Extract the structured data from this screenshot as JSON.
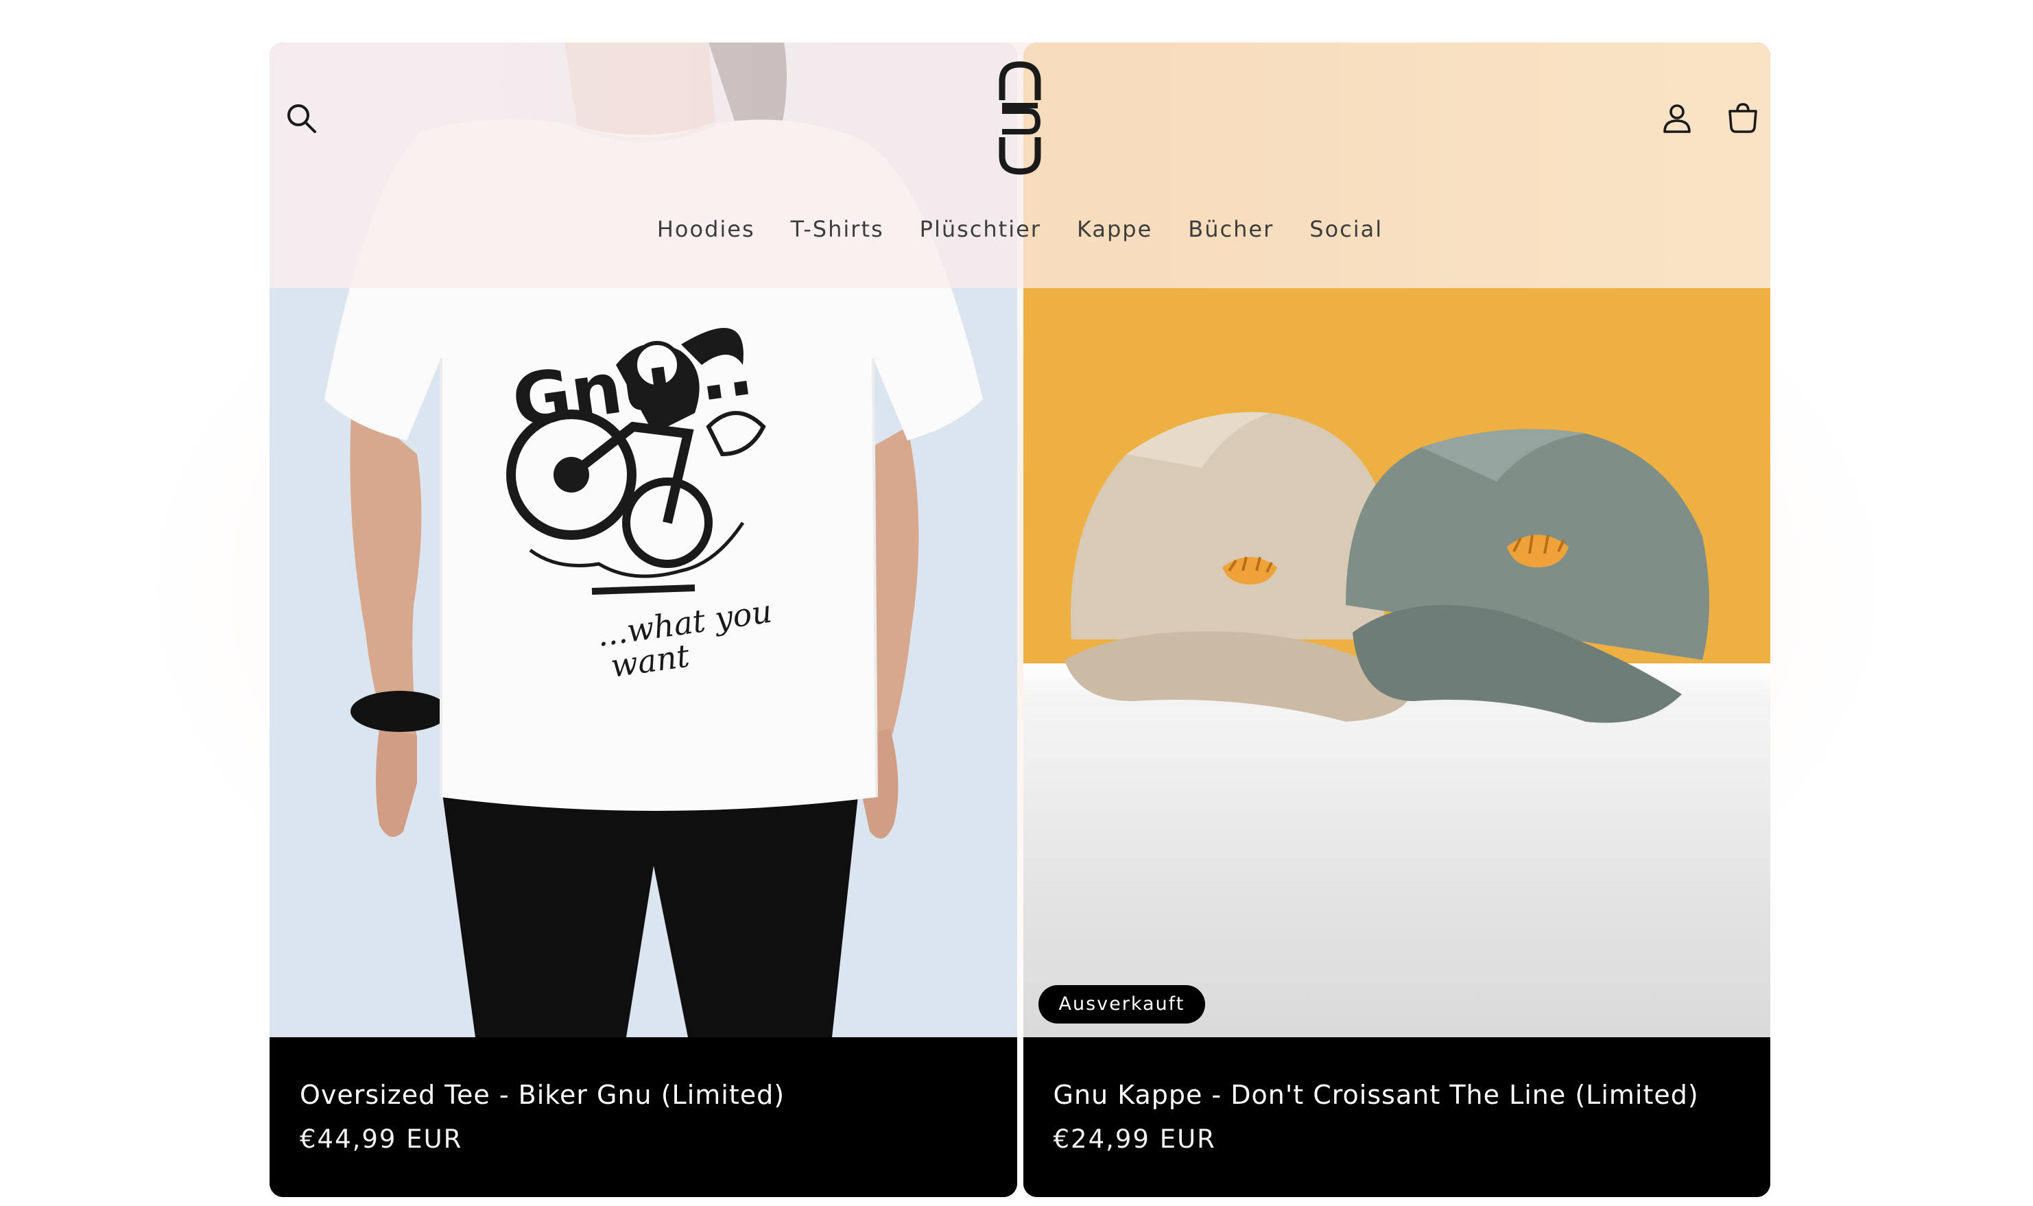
{
  "header": {
    "search_icon": "search-icon",
    "logo_icon": "gnu-logo-icon",
    "account_icon": "account-icon",
    "cart_icon": "cart-icon",
    "nav": [
      {
        "label": "Hoodies"
      },
      {
        "label": "T-Shirts"
      },
      {
        "label": "Plüschtier"
      },
      {
        "label": "Kappe"
      },
      {
        "label": "Bücher"
      },
      {
        "label": "Social"
      }
    ]
  },
  "products": [
    {
      "title": "Oversized Tee - Biker Gnu (Limited)",
      "price": "€44,99 EUR",
      "image": "tee-model-image",
      "print_text_1": "Gnu...",
      "print_text_2": "...what you",
      "print_text_3": "want"
    },
    {
      "title": "Gnu Kappe - Don't Croissant The Line (Limited)",
      "price": "€24,99 EUR",
      "image": "caps-image",
      "badge": "Ausverkauft"
    }
  ],
  "colors": {
    "tee_background": "#dbe5f0",
    "cap_background": "#eeb042",
    "info_panel": "#000000",
    "badge": "#000000"
  }
}
